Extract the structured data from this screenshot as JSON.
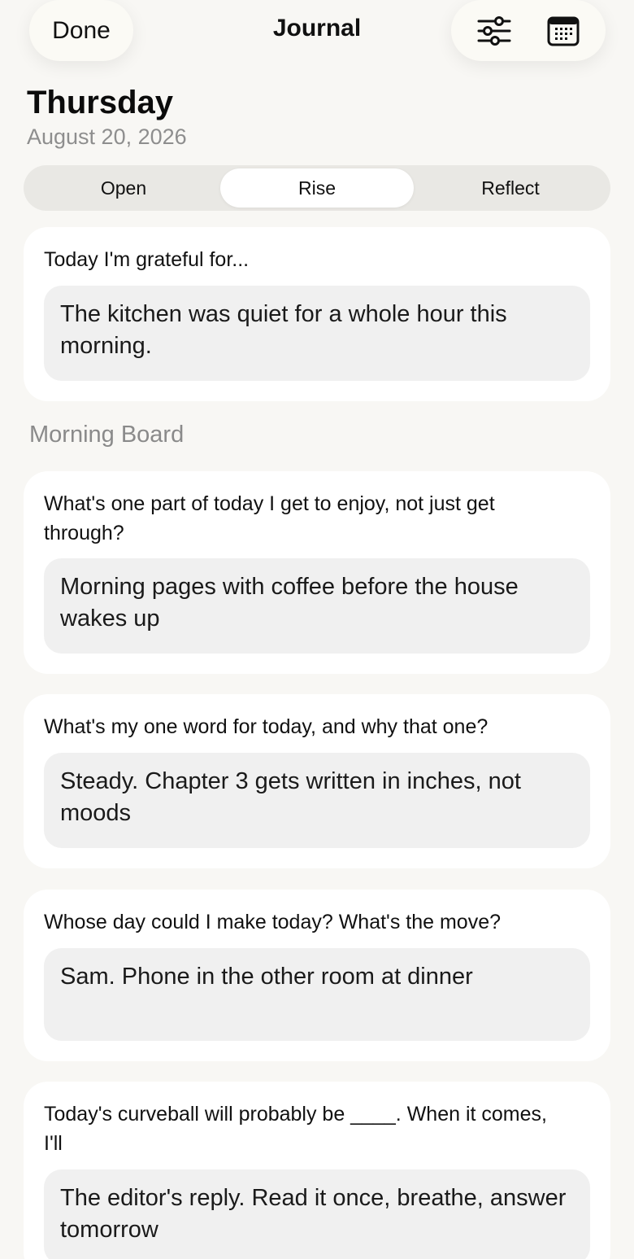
{
  "header": {
    "done_label": "Done",
    "title": "Journal",
    "filter_icon": "sliders-icon",
    "calendar_icon": "calendar-icon"
  },
  "day": {
    "weekday": "Thursday",
    "date": "August 20, 2026"
  },
  "tabs": [
    {
      "label": "Open",
      "active": false
    },
    {
      "label": "Rise",
      "active": true
    },
    {
      "label": "Reflect",
      "active": false
    }
  ],
  "gratitude": {
    "prompt": "Today I'm grateful for...",
    "answer": "The kitchen was quiet for a whole hour this morning."
  },
  "section_title": "Morning Board",
  "entries": [
    {
      "prompt": "What's one part of today I get to enjoy, not just get through?",
      "answer": "Morning pages with coffee before the house wakes up"
    },
    {
      "prompt": "What's my one word for today, and why that one?",
      "answer": "Steady. Chapter 3 gets written in inches, not moods"
    },
    {
      "prompt": "Whose day could I make today? What's the move?",
      "answer": "Sam. Phone in the other room at dinner"
    },
    {
      "prompt": "Today's curveball will probably be ____. When it comes, I'll",
      "answer": "The editor's reply. Read it once, breathe, answer tomorrow"
    }
  ]
}
